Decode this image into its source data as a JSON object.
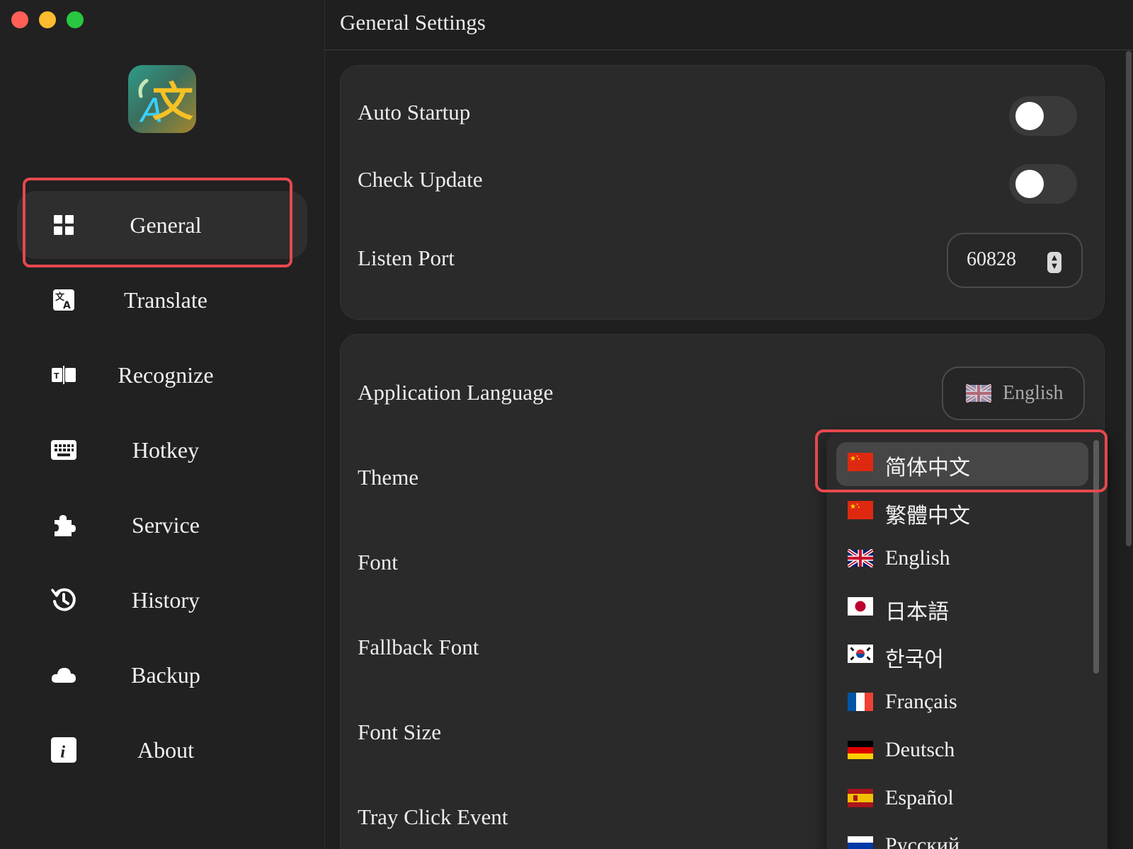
{
  "window": {
    "traffic_lights": [
      "#ff5f57",
      "#febc2e",
      "#28c840"
    ]
  },
  "sidebar": {
    "logo_icon": "translate-logo-icon",
    "items": [
      {
        "label": "General",
        "icon": "grid-icon",
        "active": true
      },
      {
        "label": "Translate",
        "icon": "translate-icon"
      },
      {
        "label": "Recognize",
        "icon": "recognize-icon"
      },
      {
        "label": "Hotkey",
        "icon": "keyboard-icon"
      },
      {
        "label": "Service",
        "icon": "puzzle-icon"
      },
      {
        "label": "History",
        "icon": "history-icon"
      },
      {
        "label": "Backup",
        "icon": "cloud-icon"
      },
      {
        "label": "About",
        "icon": "info-icon"
      }
    ]
  },
  "header": {
    "title": "General Settings"
  },
  "card1": {
    "auto_startup_label": "Auto Startup",
    "auto_startup_on": false,
    "check_update_label": "Check Update",
    "check_update_on": false,
    "listen_port_label": "Listen Port",
    "listen_port_value": "60828"
  },
  "card2": {
    "app_language_label": "Application Language",
    "app_language_value": "English",
    "theme_label": "Theme",
    "font_label": "Font",
    "fallback_font_label": "Fallback Font",
    "font_size_label": "Font Size",
    "tray_click_label": "Tray Click Event"
  },
  "dropdown": {
    "options": [
      {
        "label": "简体中文",
        "flag": "cn",
        "selected": true
      },
      {
        "label": "繁體中文",
        "flag": "cn"
      },
      {
        "label": "English",
        "flag": "gb"
      },
      {
        "label": "日本語",
        "flag": "jp"
      },
      {
        "label": "한국어",
        "flag": "kr"
      },
      {
        "label": "Français",
        "flag": "fr"
      },
      {
        "label": "Deutsch",
        "flag": "de"
      },
      {
        "label": "Español",
        "flag": "es"
      },
      {
        "label": "Русский",
        "flag": "ru"
      }
    ]
  },
  "colors": {
    "accent_highlight": "#e5484d",
    "background": "#1f1f1f",
    "card": "#2a2a2a"
  }
}
